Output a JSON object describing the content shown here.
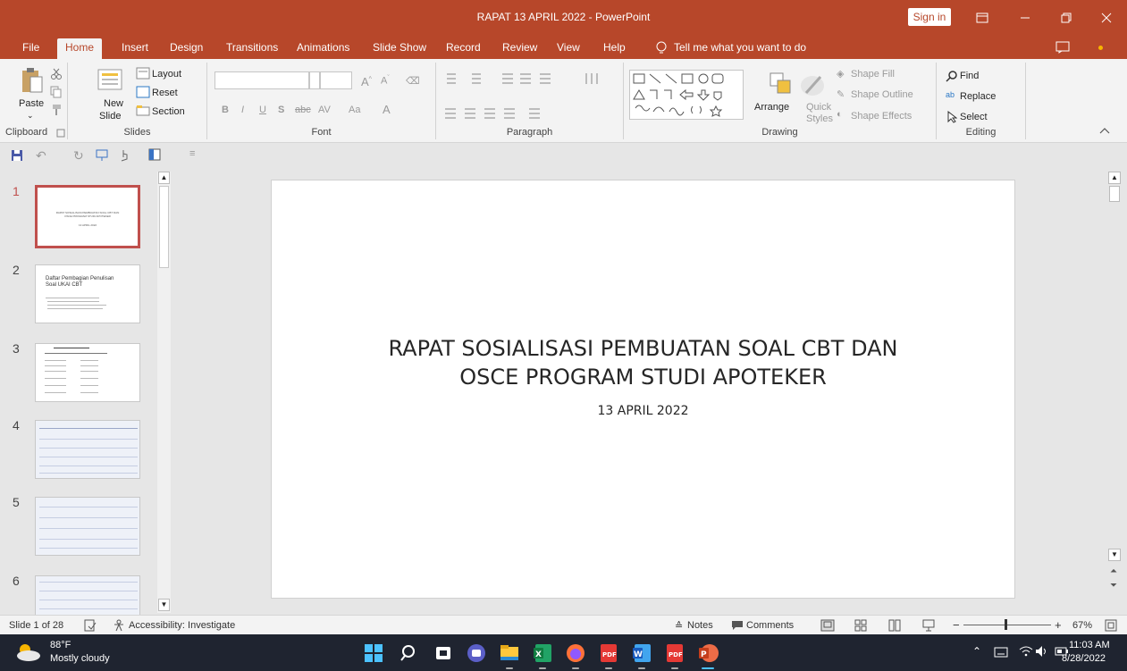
{
  "window": {
    "title": "RAPAT 13 APRIL 2022  -  PowerPoint",
    "sign_in": "Sign in"
  },
  "tabs": [
    "File",
    "Home",
    "Insert",
    "Design",
    "Transitions",
    "Animations",
    "Slide Show",
    "Record",
    "Review",
    "View",
    "Help"
  ],
  "tell_me": "Tell me what you want to do",
  "ribbon": {
    "clipboard": {
      "paste": "Paste",
      "label": "Clipboard"
    },
    "slides": {
      "new_slide_1": "New",
      "new_slide_2": "Slide",
      "layout": "Layout",
      "reset": "Reset",
      "section": "Section",
      "label": "Slides"
    },
    "font": {
      "label": "Font",
      "bold": "B",
      "italic": "I",
      "underline": "U",
      "shadow": "S",
      "strike": "abc",
      "aa": "Aa",
      "a": "A"
    },
    "paragraph": {
      "label": "Paragraph"
    },
    "drawing": {
      "arrange": "Arrange",
      "quick_1": "Quick",
      "quick_2": "Styles",
      "shape_fill": "Shape Fill",
      "shape_outline": "Shape Outline",
      "shape_effects": "Shape Effects",
      "label": "Drawing"
    },
    "editing": {
      "find": "Find",
      "replace": "Replace",
      "select": "Select",
      "label": "Editing"
    }
  },
  "thumbnails": [
    {
      "num": "1",
      "title": "RAPAT SOSIALISASI PEMBUATAN SOAL CBT DAN OSCE PROGRAM STUDI APOTEKER",
      "sub": "13 APRIL 2022"
    },
    {
      "num": "2",
      "title": "Daftar Pembagian Penulisan Soal UKAI CBT"
    },
    {
      "num": "3"
    },
    {
      "num": "4"
    },
    {
      "num": "5"
    },
    {
      "num": "6"
    }
  ],
  "slide": {
    "title_line1": "RAPAT SOSIALISASI PEMBUATAN SOAL CBT DAN",
    "title_line2": "OSCE PROGRAM STUDI APOTEKER",
    "subtitle": "13 APRIL 2022"
  },
  "status": {
    "slide_info": "Slide 1 of 28",
    "accessibility": "Accessibility: Investigate",
    "notes": "Notes",
    "comments": "Comments",
    "zoom": "67%",
    "zoom_fraction": 0.67
  },
  "taskbar": {
    "temp": "88°F",
    "weather": "Mostly cloudy",
    "time": "11:03 AM",
    "date": "8/28/2022"
  },
  "colors": {
    "accent": "#b7472a",
    "taskbar": "#1f2430"
  }
}
